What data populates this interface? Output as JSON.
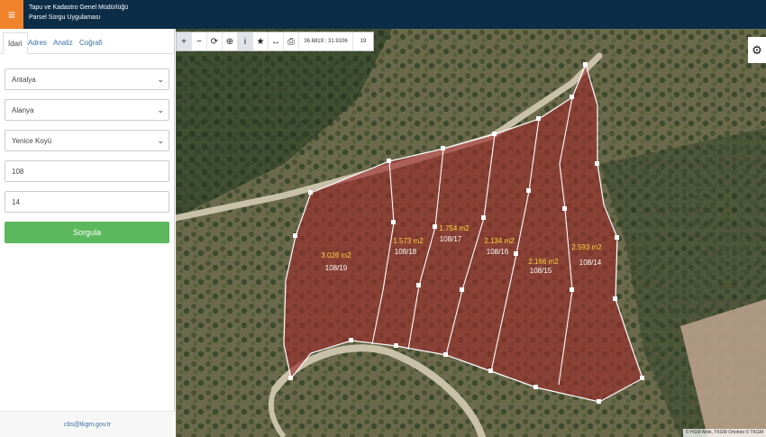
{
  "header": {
    "org_name": "Tapu ve Kadastro Genel Müdürlüğü",
    "app_name": "Parsel Sorgu Uygulaması",
    "menu_icon": "hamburger-icon"
  },
  "colors": {
    "header_bg": "#0c2d48",
    "menu_btn": "#f0842c",
    "query_btn": "#5cb85c",
    "parcel_fill": "#9b2d2d",
    "area_label": "#ffd43b"
  },
  "sidebar": {
    "tabs": [
      {
        "label": "İdari",
        "active": true
      },
      {
        "label": "Adres",
        "active": false
      },
      {
        "label": "Analiz",
        "active": false
      },
      {
        "label": "Coğrafi",
        "active": false
      }
    ],
    "province": "Antalya",
    "district": "Alanya",
    "neighborhood": "Yenice Koyü",
    "block": "108",
    "parcel": "14",
    "query_label": "Sorgula",
    "footer_email": "cbs@tkgm.gov.tr"
  },
  "toolbar": {
    "tools": [
      "zoom-in-icon",
      "zoom-out-icon",
      "refresh-icon",
      "locate-icon",
      "info-icon",
      "star-icon",
      "measure-icon",
      "print-icon"
    ],
    "coords": "36.6819 : 31.9106",
    "zoom_level": "19"
  },
  "map": {
    "attribution": "© HGM Altlık, TKGM Ortofoto © TKGM",
    "parcels": [
      {
        "area": "3.026 m2",
        "id": "108/19"
      },
      {
        "area": "1.573 m2",
        "id": "108/18"
      },
      {
        "area": "1.754 m2",
        "id": "108/17"
      },
      {
        "area": "2.134 m2",
        "id": "108/16"
      },
      {
        "area": "2.166 m2",
        "id": "108/15"
      },
      {
        "area": "2.593 m2",
        "id": "108/14"
      }
    ]
  }
}
